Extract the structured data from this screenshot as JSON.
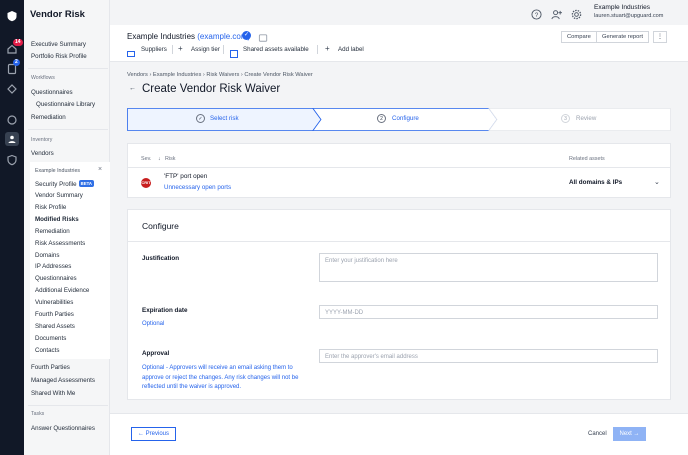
{
  "app": {
    "title": "Vendor Risk"
  },
  "rail": {
    "badge_notifications": "14",
    "badge_tasks": "2"
  },
  "sidebar": {
    "items_top": [
      "Executive Summary",
      "Portfolio Risk Profile"
    ],
    "workflows_header": "Workflows",
    "workflows": [
      "Questionnaires",
      "Questionnaire Library",
      "Remediation"
    ],
    "inventory_header": "Inventory",
    "inventory": [
      "Vendors"
    ],
    "vendor_header": "Example Industries",
    "vendor_items": [
      "Security Profile",
      "Vendor Summary",
      "Risk Profile",
      "Modified Risks",
      "Remediation",
      "Risk Assessments",
      "Domains",
      "IP Addresses",
      "Questionnaires",
      "Additional Evidence",
      "Vulnerabilities",
      "Fourth Parties",
      "Shared Assets",
      "Documents",
      "Contacts"
    ],
    "beta": "BETA",
    "items_after": [
      "Fourth Parties",
      "Managed Assessments",
      "Shared With Me"
    ],
    "tasks_header": "Tasks",
    "tasks": [
      "Answer Questionnaires"
    ],
    "close_glyph": "×"
  },
  "topbar": {
    "user_name": "Example Industries",
    "user_email": "lauren.stuart@upguard.com"
  },
  "vendor": {
    "name": "Example Industries",
    "domain": "(example.com)",
    "links": [
      "Suppliers",
      "Assign tier",
      "Shared assets available",
      "Add label"
    ],
    "compare": "Compare",
    "generate_report": "Generate report",
    "more": "⋮"
  },
  "breadcrumb": "Vendors  ›  Example Industries  ›  Risk Waivers  ›  Create Vendor Risk Waiver",
  "page": {
    "title": "Create Vendor Risk Waiver",
    "back": "←"
  },
  "stepper": {
    "steps": [
      {
        "num": "✓",
        "label": "Select risk"
      },
      {
        "num": "2",
        "label": "Configure"
      },
      {
        "num": "3",
        "label": "Review"
      }
    ]
  },
  "risk_table": {
    "col_sev": "Sev.",
    "col_risk": "Risk",
    "col_assets": "Related assets",
    "sev_label": "CRIT",
    "risk_title": "'FTP' port open",
    "risk_desc": "Unnecessary open ports",
    "assets": "All domains & IPs",
    "expand": "⌄"
  },
  "configure": {
    "title": "Configure",
    "justification_label": "Justification",
    "justification_placeholder": "Enter your justification here",
    "expiry_label": "Expiration date",
    "expiry_help": "Optional",
    "expiry_placeholder": "YYYY-MM-DD",
    "approval_label": "Approval",
    "approval_help": "Optional - Approvers will receive an email asking them to approve or reject the changes. Any risk changes will not be reflected until the waiver is approved.",
    "approval_placeholder": "Enter the approver's email address"
  },
  "footer": {
    "previous": "← Previous",
    "cancel": "Cancel",
    "next": "Next →"
  },
  "colors": {
    "accent": "#2563eb",
    "rail": "#111827",
    "critical": "#c81e1e",
    "next_disabled": "#8fb3f5"
  }
}
